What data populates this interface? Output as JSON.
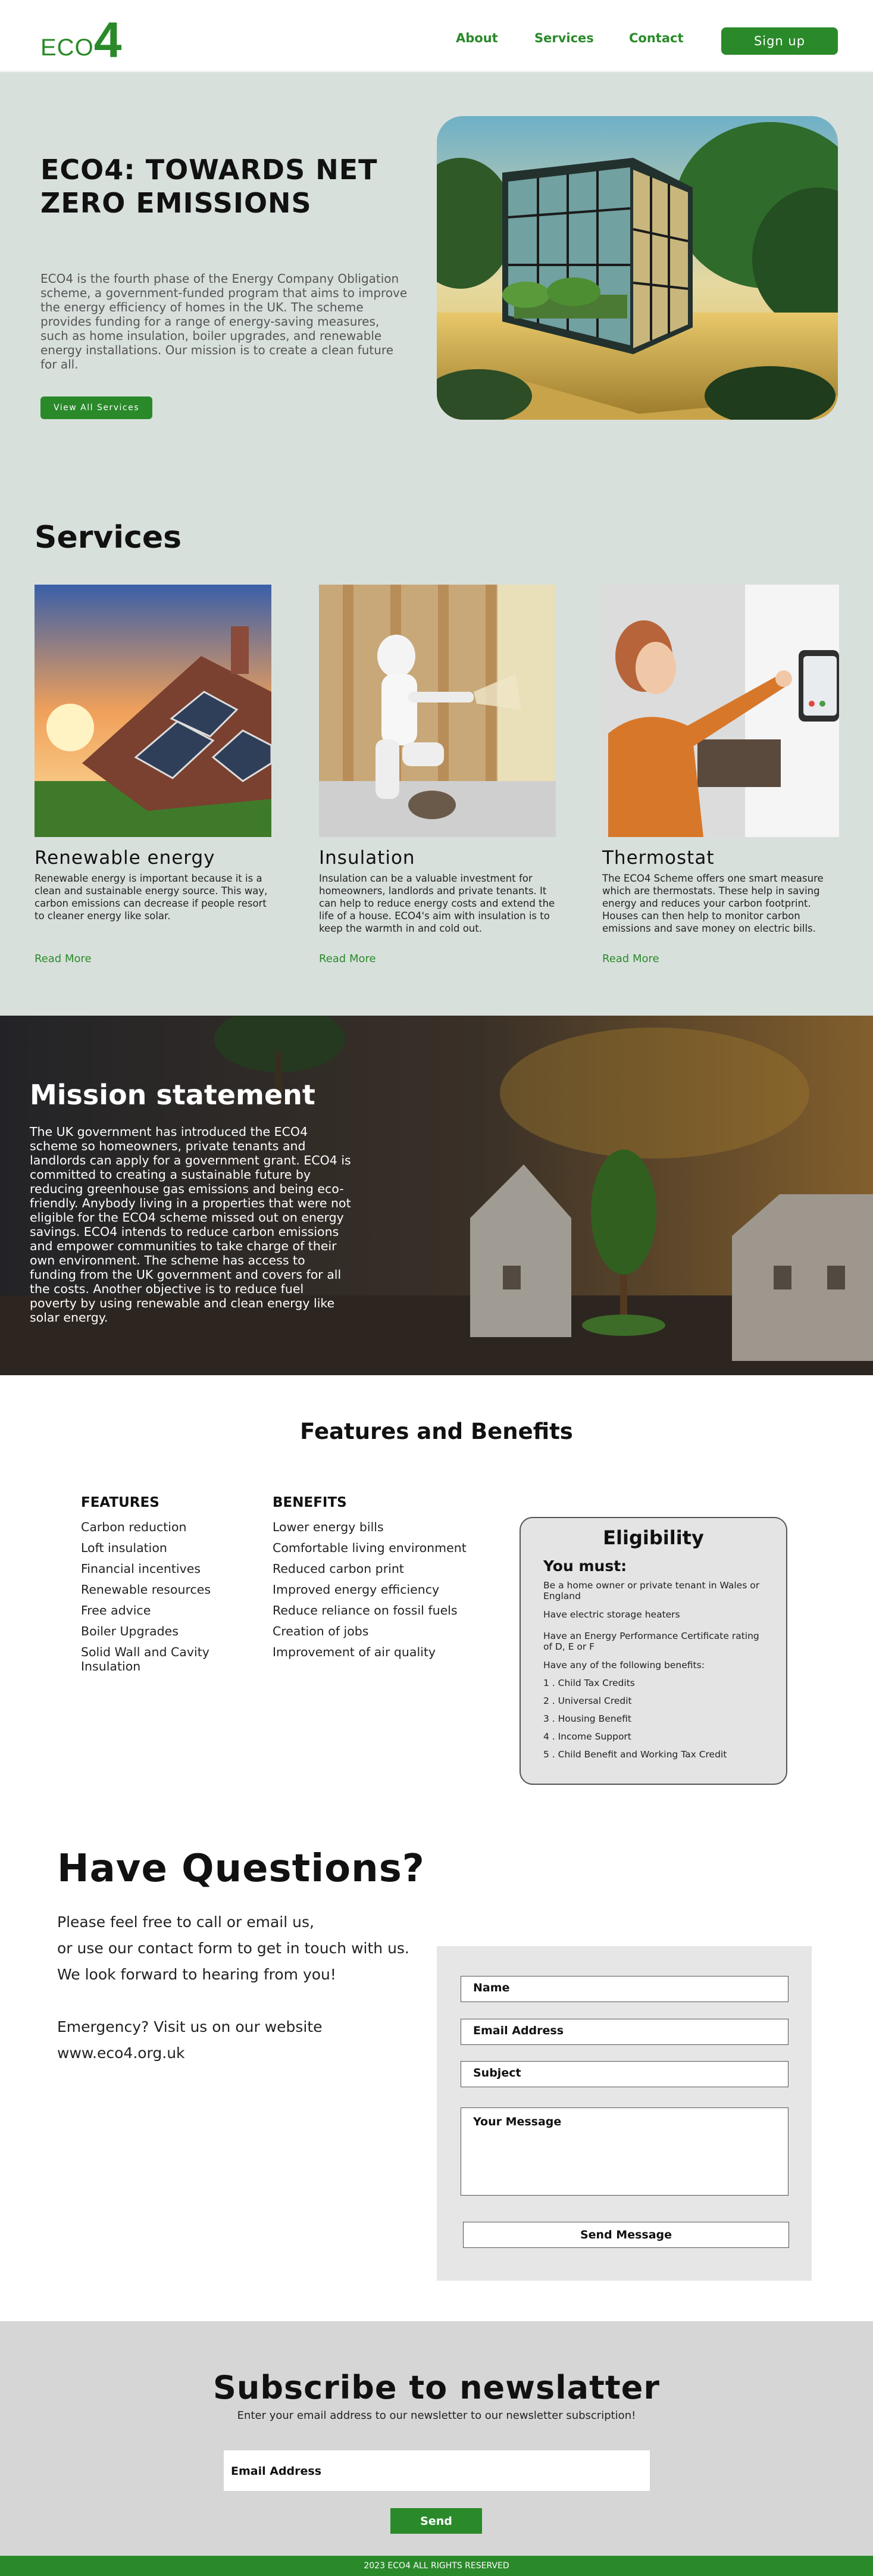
{
  "nav": {
    "logo_text": "ECO",
    "logo_number": "4",
    "links": [
      "About",
      "Services",
      "Contact"
    ],
    "signup_label": "Sign up"
  },
  "hero": {
    "title": "ECO4: TOWARDS NET ZERO EMISSIONS",
    "text": "ECO4 is the fourth phase of the Energy Company Obligation scheme, a government-funded program that aims to improve the energy efficiency of homes in the UK. The scheme provides funding for a range of energy-saving measures, such as home insulation, boiler upgrades, and renewable energy installations. Our mission is to create a clean future for all.",
    "button_label": "View All Services"
  },
  "services": {
    "title": "Services",
    "cards": [
      {
        "title": "Renewable  energy",
        "text": "Renewable energy is important because it is a clean and sustainable energy source. This way, carbon emissions can decrease if people resort to cleaner energy like solar.",
        "link": "Read More"
      },
      {
        "title": "Insulation",
        "text": "Insulation can be a valuable investment for homeowners, landlords and private tenants. It can help to reduce energy costs and extend the life of a house. ECO4's aim with insulation is to keep the warmth in and cold out.",
        "link": "Read More"
      },
      {
        "title": "Thermostat",
        "text": "The ECO4 Scheme offers one smart measure which are thermostats. These help in saving energy and reduces your carbon footprint. Houses can then help to monitor carbon emissions and save money on electric bills.",
        "link": "Read More"
      }
    ]
  },
  "mission": {
    "title": "Mission statement",
    "text": "The UK government has introduced the ECO4 scheme so homeowners, private tenants and landlords can apply for a government grant. ECO4 is committed to creating a sustainable future by reducing greenhouse gas emissions and being eco-friendly. Anybody living in a properties that were not eligible for the ECO4 scheme missed out on energy savings. ECO4 intends to reduce carbon emissions and empower communities to take charge of their own environment. The scheme has access to funding from the UK government and covers for all the costs. Another objective is to reduce fuel poverty by using renewable and clean energy like solar energy."
  },
  "features": {
    "title": "Features and Benefits",
    "features_heading": "FEATURES",
    "features": [
      "Carbon reduction",
      "Loft insulation",
      "Financial incentives",
      "Renewable resources",
      "Free advice",
      "Boiler Upgrades",
      "Solid Wall and Cavity Insulation"
    ],
    "benefits_heading": "BENEFITS",
    "benefits": [
      "Lower energy bills",
      "Comfortable living environment",
      "Reduced carbon print",
      "Improved energy efficiency",
      "Reduce reliance on fossil fuels",
      "Creation of jobs",
      "Improvement of air quality"
    ],
    "eligibility": {
      "title": "Eligibility",
      "subtitle": "You must:",
      "items": [
        "Be a home owner or private tenant in Wales or England",
        "Have electric storage heaters",
        "Have an Energy Performance Certificate rating of D, E or F",
        "Have any of the following benefits:",
        "1 . Child Tax Credits",
        "2 . Universal Credit",
        "3 . Housing Benefit",
        "4 . Income Support",
        "5 . Child Benefit and Working Tax Credit"
      ]
    }
  },
  "contact": {
    "title": "Have Questions?",
    "lines": [
      "Please feel free to call or email us,",
      "or use our contact form to get in touch with us.",
      "We look forward to hearing from you!",
      "",
      "Emergency? Visit us on our website",
      "www.eco4.org.uk"
    ],
    "name_placeholder": "Name",
    "email_placeholder": "Email Address",
    "subject_placeholder": "Subject",
    "message_placeholder": "Your Message",
    "send_label": "Send Message"
  },
  "newsletter": {
    "title": "Subscribe  to newslatter",
    "text": "Enter your email address to our newsletter to our newsletter subscription!",
    "email_placeholder": "Email Address",
    "button_label": "Send"
  },
  "footer": {
    "text": "2023 ECO4 ALL RIGHTS RESERVED"
  },
  "colors": {
    "brand_green": "#2a8a2a",
    "hero_bg": "#d8e0dc",
    "panel_grey": "#e6e6e6"
  }
}
